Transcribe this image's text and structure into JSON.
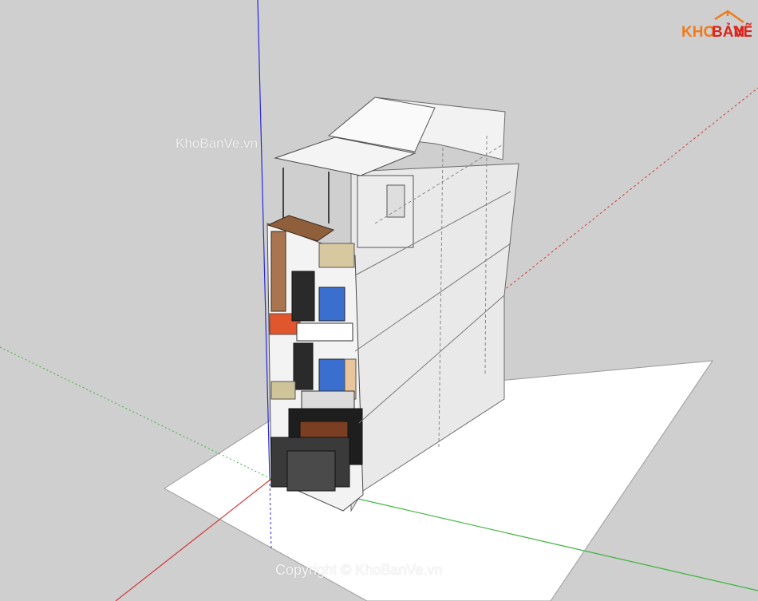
{
  "watermarks": {
    "center": "KhoBanVe.vn",
    "bottom": "Copyright © KhoBanVe.vn"
  },
  "logo": {
    "part1": "KHO",
    "part2": "BẢN",
    "part3": "VẼ"
  },
  "colors": {
    "background": "#cfcfcf",
    "axis_blue": "#2a2ad8",
    "axis_red": "#d43a3a",
    "axis_green": "#3ab43a",
    "ground": "#ffffff",
    "logo_orange": "#f07a1e",
    "logo_red": "#d9261c"
  }
}
